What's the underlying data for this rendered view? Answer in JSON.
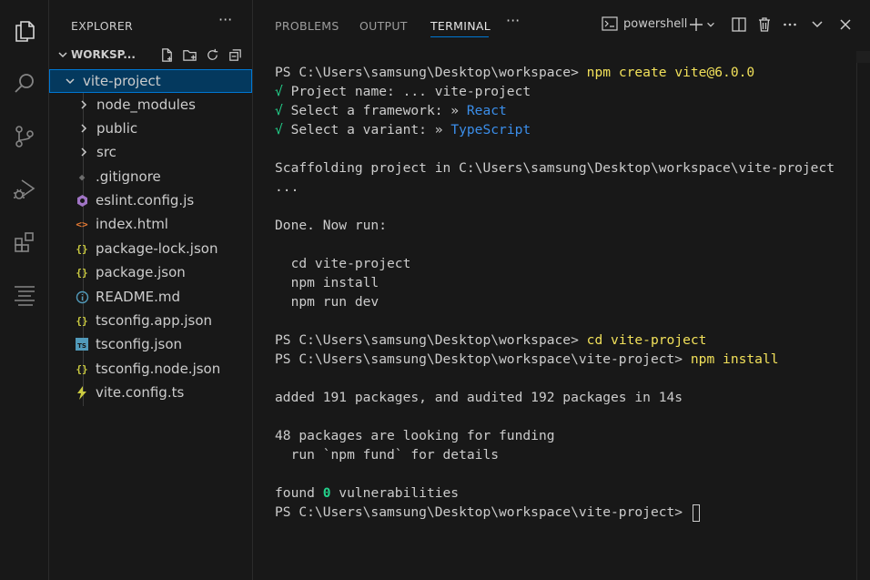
{
  "activity_bar": {
    "icons": [
      "explorer-icon",
      "search-icon",
      "source-control-icon",
      "run-debug-icon",
      "extensions-icon",
      "outline-icon"
    ]
  },
  "explorer": {
    "title": "EXPLORER",
    "more": "···",
    "workspace_label": "WORKSP...",
    "tree": [
      {
        "label": "vite-project",
        "type": "folder",
        "expanded": true,
        "selected": true
      },
      {
        "label": "node_modules",
        "type": "folder",
        "expanded": false
      },
      {
        "label": "public",
        "type": "folder",
        "expanded": false
      },
      {
        "label": "src",
        "type": "folder",
        "expanded": false
      },
      {
        "label": ".gitignore",
        "type": "file",
        "icon": "git-icon"
      },
      {
        "label": "eslint.config.js",
        "type": "file",
        "icon": "eslint-icon"
      },
      {
        "label": "index.html",
        "type": "file",
        "icon": "html-icon"
      },
      {
        "label": "package-lock.json",
        "type": "file",
        "icon": "json-icon"
      },
      {
        "label": "package.json",
        "type": "file",
        "icon": "json-icon"
      },
      {
        "label": "README.md",
        "type": "file",
        "icon": "info-icon"
      },
      {
        "label": "tsconfig.app.json",
        "type": "file",
        "icon": "json-icon"
      },
      {
        "label": "tsconfig.json",
        "type": "file",
        "icon": "typescript-icon"
      },
      {
        "label": "tsconfig.node.json",
        "type": "file",
        "icon": "json-icon"
      },
      {
        "label": "vite.config.ts",
        "type": "file",
        "icon": "vite-icon"
      }
    ]
  },
  "panel": {
    "tabs": [
      "PROBLEMS",
      "OUTPUT",
      "TERMINAL"
    ],
    "active_tab": "TERMINAL",
    "more": "···",
    "shell_label": "powershell"
  },
  "terminal": {
    "prompt1": "PS C:\\Users\\samsung\\Desktop\\workspace> ",
    "cmd1": "npm create vite@6.0.0",
    "q1": " Project name: ... vite-project",
    "q2_prefix": " Select a framework: » ",
    "q2_value": "React",
    "q3_prefix": " Select a variant: » ",
    "q3_value": "TypeScript",
    "check": "√",
    "scaffold": "Scaffolding project in C:\\Users\\samsung\\Desktop\\workspace\\vite-project",
    "ellipsis": "...",
    "done": "Done. Now run:",
    "step1": "  cd vite-project",
    "step2": "  npm install",
    "step3": "  npm run dev",
    "prompt2": "PS C:\\Users\\samsung\\Desktop\\workspace> ",
    "cmd2": "cd vite-project",
    "prompt3": "PS C:\\Users\\samsung\\Desktop\\workspace\\vite-project> ",
    "cmd3": "npm install",
    "added": "added 191 packages, and audited 192 packages in 14s",
    "funding1": "48 packages are looking for funding",
    "funding2": "  run `npm fund` for details",
    "found_prefix": "found ",
    "found_num": "0",
    "found_suffix": " vulnerabilities",
    "prompt4": "PS C:\\Users\\samsung\\Desktop\\workspace\\vite-project> "
  },
  "colors": {
    "background": "#181818",
    "command": "#f1e05a",
    "check": "#23d18b",
    "accent": "#3b8eea",
    "selection": "#04395e"
  }
}
